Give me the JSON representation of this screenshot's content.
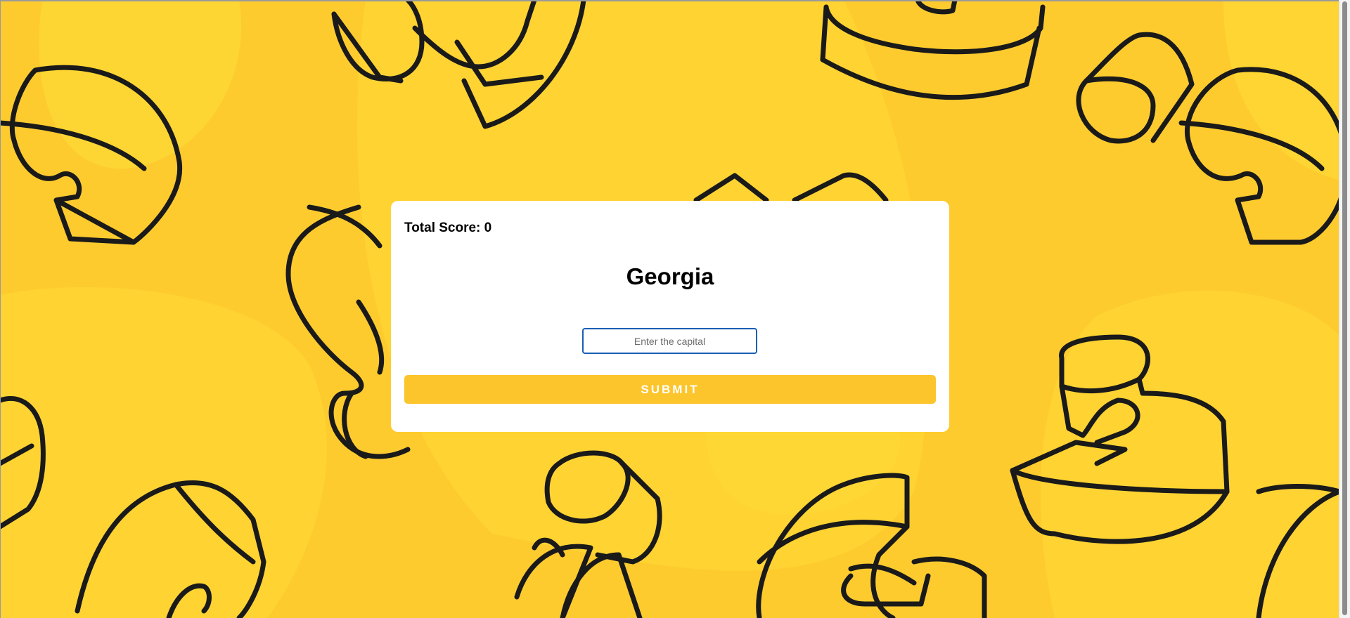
{
  "score": {
    "label": "Total Score: 0"
  },
  "question": {
    "state": "Georgia"
  },
  "answer_input": {
    "value": "",
    "placeholder": "Enter the capital"
  },
  "submit": {
    "label": "SUBMIT"
  },
  "colors": {
    "background": "#FECB2E",
    "accent": "#FCC52C",
    "card": "#FFFFFF",
    "outline": "#1A1A1A",
    "input_border": "#1A5FB4"
  },
  "decorations": {
    "icon": "3d-letter-doodles"
  }
}
